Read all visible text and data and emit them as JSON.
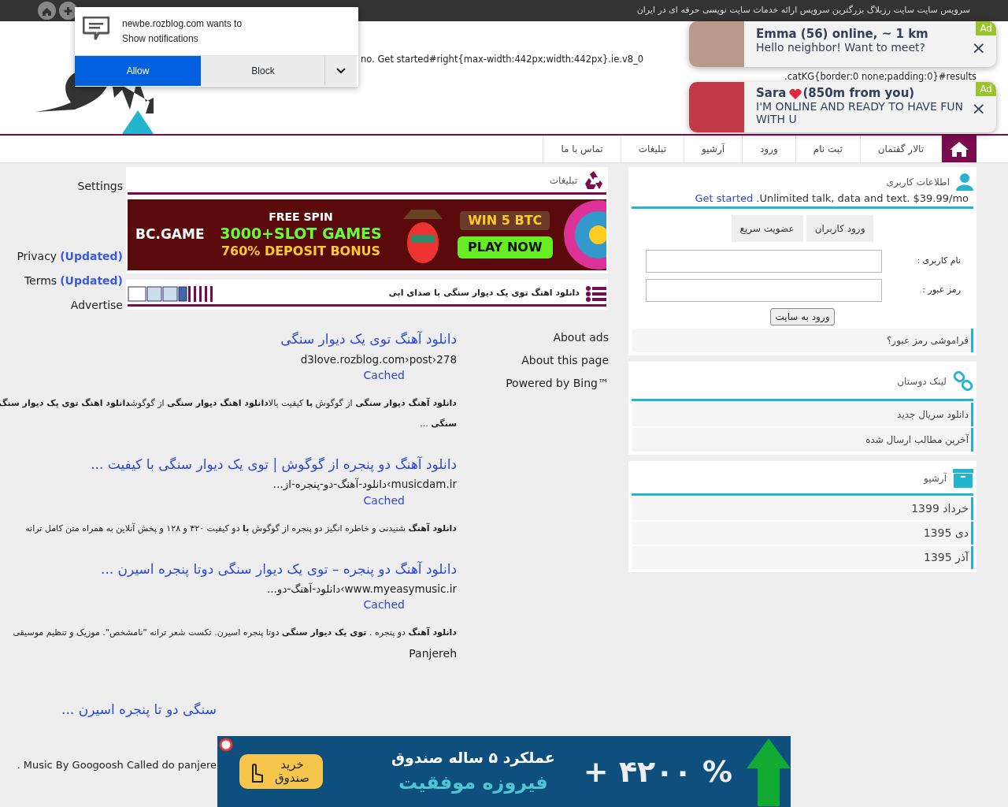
{
  "top_bar": {
    "text": "سرویس سایت سایت رزبلاگ بزرگترین سرویس ارائه خدمات سایت نویسی حرفه ای در ایران"
  },
  "notification_prompt": {
    "message": "newbe.rozblog.com wants to",
    "detail": "Show notifications",
    "allow": "Allow",
    "block": "Block"
  },
  "header": {
    "code_lines": [
      "no. Get started#right{max-width:442px;width:442px}.ie.v8_0",
      ".catKG{border:0 none;padding:0}#results"
    ]
  },
  "popup_ads": [
    {
      "kind": "plain",
      "title": "Emma (56) online, ~ 1 km",
      "message": "Hello neighbor! Want to meet?",
      "badge": "Ad",
      "close": "×"
    },
    {
      "kind": "heart",
      "title": "Sara",
      "title_after": "(850m from you)",
      "message": "I'M ONLINE AND READY TO HAVE FUN WITH U",
      "badge": "Ad",
      "close": "×"
    }
  ],
  "nav": {
    "home": {
      "selected": true
    },
    "items": [
      {
        "label": "تالار گفتمان",
        "selected": false
      },
      {
        "label": "ثبت نام",
        "selected": false
      },
      {
        "label": "ورود",
        "selected": false
      },
      {
        "label": "آرشیو",
        "selected": false
      },
      {
        "label": "تبلیغات",
        "selected": false
      },
      {
        "label": "تماس با ما",
        "selected": false
      }
    ]
  },
  "bing_links": [
    {
      "label": "Settings"
    },
    {
      "label": "Privacy",
      "tag": "(Updated)"
    },
    {
      "label": "Terms",
      "tag": "(Updated)"
    },
    {
      "label": "Advertise"
    }
  ],
  "ads_box": {
    "title": "تبلیغات",
    "post_bar": "دانلود اهنگ توی یک دیوار سنگی با صدای ابی"
  },
  "banner_ad": {
    "brand": "BC.GAME",
    "line1": "FREE SPIN",
    "line2": "3000+SLOT GAMES",
    "line3": "760% DEPOSIT BONUS",
    "win": "WIN 5 BTC",
    "cta": "PLAY NOW"
  },
  "results": [
    {
      "title": "دانلود آهنگ توی یک دیوار سنگی",
      "url": "d3love.rozblog.com›post›278",
      "cached": "Cached",
      "snippet": [
        "**دانلود آهنگ دیوار سنگی** از گوگوش **با** کیفیت بالا**دانلود اهنگ دیوار سنگی** از گوگوش**دانلود اهنگ توی یک دیوار سنگ**",
        "**سنگی** ..."
      ]
    },
    {
      "title": "دانلود آهنگ دو پنجره از گوگوش | توی یک دیوار سنگی با کیفیت ...",
      "url": "musicdam.ir›دانلود-آهنگ-دو-پنجره-از...",
      "cached": "Cached",
      "snippet": [
        "**دانلود آهنگ** شنیدنی و خاطره انگیز دو پنجره از گوگوش **با** دو کیفیت ۳۲۰ و ۱۲۸ و پخش آنلاین به همراه متن کامل ترانه"
      ]
    },
    {
      "title": "دانلود آهنگ دو پنجره – توی یک دیوار سنگی دوتا پنجره اسیرن ...",
      "url": "www.myeasymusic.ir›دانلود-آهنگ-دو...",
      "cached": "Cached",
      "snippet": [
        "**دانلود آهنگ** دو پنجره . **توی یک دیوار سنگی** دوتا پنجره اسیرن. تکست شعر ترانه \"نامشخص\". موزیک و تنظیم موسیقی",
        "Panjereh"
      ]
    },
    {
      "title": "سنگی دو تا پنجره اسیرن ...",
      "snippet": [
        "Music By Googoosh Called do panjere ."
      ]
    }
  ],
  "about_links": [
    "About ads",
    "About this page",
    "Powered by Bing™"
  ],
  "user_box": {
    "title": "اطلاعات کاربری",
    "promo_link": "Get started",
    "promo_text": ".Unlimited talk, data and text. $39.99/mo",
    "tabs": [
      {
        "label": "ورود کاربران",
        "selected": false
      },
      {
        "label": "عضویت سریع",
        "selected": false
      }
    ],
    "fields": [
      {
        "label": "نام کاربری :"
      },
      {
        "label": "رمز عبور :"
      }
    ],
    "submit": "ورود به سایت",
    "forgot": "فراموشی رمز عبور؟"
  },
  "friends_box": {
    "title": "لینک دوستان",
    "items": [
      "دانلود سریال جدید",
      "آخرین مطالب ارسال شده"
    ]
  },
  "archive_box": {
    "title": "آرشیو",
    "items": [
      "خرداد 1399",
      "دی 1395",
      "آذر 1395"
    ]
  },
  "bottom_ad": {
    "headline": "عملکرد ۵ ساله صندوق",
    "subline": "فیروزه موفقیت",
    "figure": "+ ۴۲۰۰ %",
    "cta": "خرید صندوق"
  }
}
